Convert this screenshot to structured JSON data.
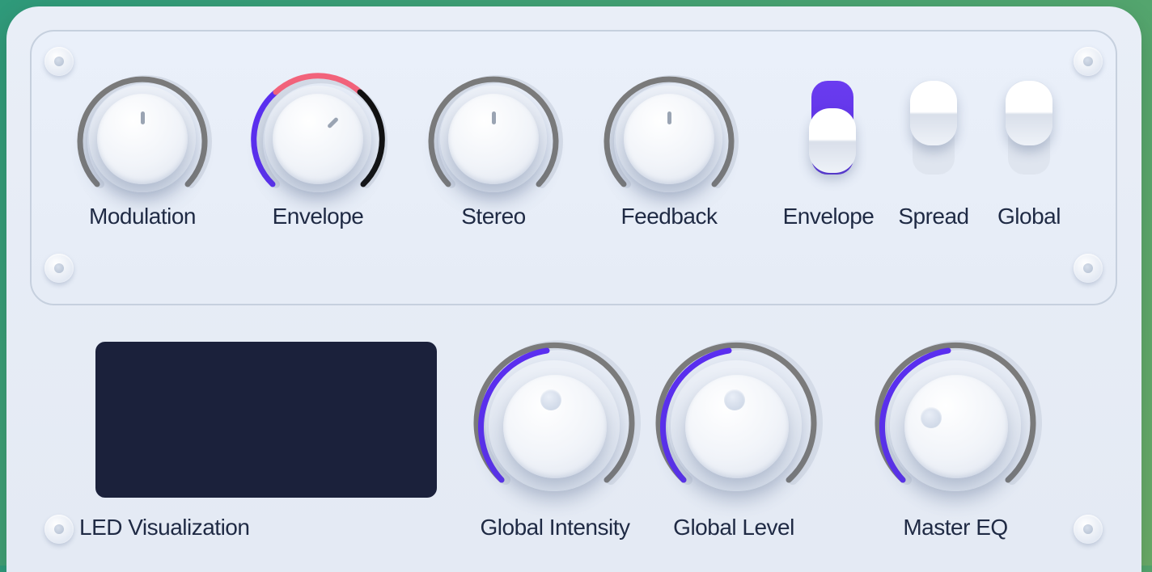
{
  "colors": {
    "accent": "#5b2ff0",
    "envelope_top_arc": "#f2637b",
    "track": "#7b7b7b",
    "display": "#1b213b"
  },
  "top_knobs": [
    {
      "label": "Modulation"
    },
    {
      "label": "Envelope"
    },
    {
      "label": "Stereo"
    },
    {
      "label": "Feedback"
    }
  ],
  "toggles": [
    {
      "label": "Envelope",
      "state": "on"
    },
    {
      "label": "Spread",
      "state": "off"
    },
    {
      "label": "Global",
      "state": "off"
    }
  ],
  "display": {
    "label": "LED Visualization"
  },
  "big_knobs": [
    {
      "label": "Global Intensity"
    },
    {
      "label": "Global Level"
    },
    {
      "label": "Master EQ"
    }
  ]
}
